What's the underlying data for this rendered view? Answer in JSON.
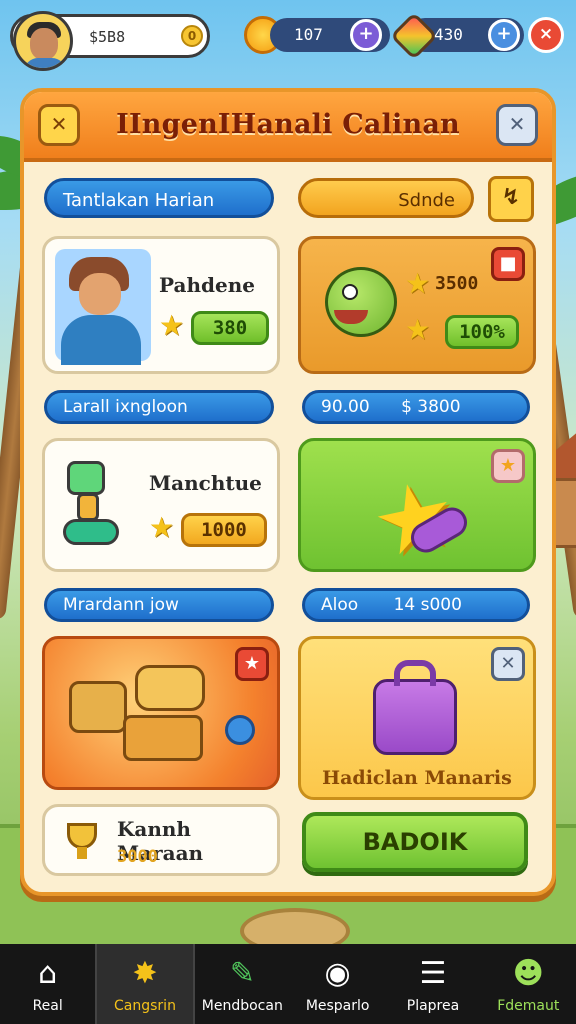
{
  "hud": {
    "player_cash": "$5B8",
    "coin_badge": "0",
    "sun_amount": "107",
    "gem_amount": "430",
    "plus_symbol": "+",
    "close_symbol": "×"
  },
  "panel": {
    "title": "IIngenIHanali Calinan",
    "left_close_symbol": "✕",
    "right_close_symbol": "✕"
  },
  "rows": {
    "row1_left_bar": "Tantlakan Harian",
    "row1_right_bar": "Sdnde",
    "row2_left_bar": "Larall ixngloon",
    "row2_right_bar_a": "90.00",
    "row2_right_bar_b": "$ 3800",
    "row3_left_bar": "Mrardann jow",
    "row3_right_bar_a": "Aloo",
    "row3_right_bar_b": "14 s000"
  },
  "cards": {
    "pahdene": {
      "name": "Pahdene",
      "value": "380"
    },
    "fish": {
      "value_top": "3500",
      "value_bottom": "100%"
    },
    "manchtue": {
      "name": "Manchtue",
      "value": "1000"
    },
    "bag": {
      "caption": "Hadiclan Manaris"
    },
    "kanah": {
      "name": "Kannh Maraan",
      "value": "3000"
    }
  },
  "action_button": {
    "label": "BADOIK"
  },
  "nav": {
    "items": [
      {
        "label": "Real",
        "glyph": "⌂"
      },
      {
        "label": "Cangsrin",
        "glyph": "✸"
      },
      {
        "label": "Mendbocan",
        "glyph": "✎"
      },
      {
        "label": "Mesparlo",
        "glyph": "◉"
      },
      {
        "label": "Plaprea",
        "glyph": "☰"
      },
      {
        "label": "Fdemaut",
        "glyph": "☻"
      }
    ]
  },
  "colors": {
    "panel_border": "#e8962a",
    "header_orange": "#f07f1c",
    "bar_blue": "#1f6fcc",
    "accent_green": "#6fc231",
    "nav_bg": "#161616"
  }
}
